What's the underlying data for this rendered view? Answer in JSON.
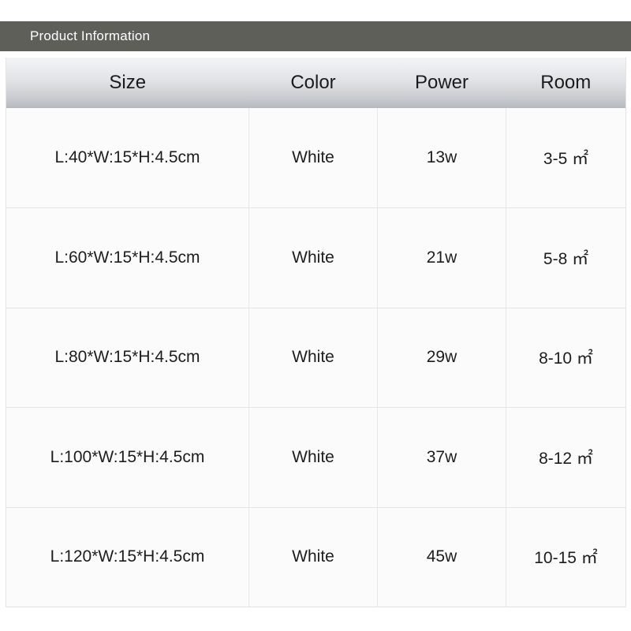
{
  "banner": {
    "title": "Product Information",
    "background_color": "#5f5f5a",
    "text_color": "#ffffff"
  },
  "table": {
    "columns": [
      {
        "key": "size",
        "label": "Size"
      },
      {
        "key": "color",
        "label": "Color"
      },
      {
        "key": "power",
        "label": "Power"
      },
      {
        "key": "room",
        "label": "Room"
      }
    ],
    "header_gradient_top": "#f2f3f5",
    "header_gradient_bottom": "#b4b7bc",
    "cell_background": "#fbfbfb",
    "border_color": "#e4e5e7",
    "rows": [
      {
        "size": "L:40*W:15*H:4.5cm",
        "color": "White",
        "power": "13w",
        "room": "3-5 ㎡"
      },
      {
        "size": "L:60*W:15*H:4.5cm",
        "color": "White",
        "power": "21w",
        "room": "5-8 ㎡"
      },
      {
        "size": "L:80*W:15*H:4.5cm",
        "color": "White",
        "power": "29w",
        "room": "8-10 ㎡"
      },
      {
        "size": "L:100*W:15*H:4.5cm",
        "color": "White",
        "power": "37w",
        "room": "8-12 ㎡"
      },
      {
        "size": "L:120*W:15*H:4.5cm",
        "color": "White",
        "power": "45w",
        "room": "10-15 ㎡"
      }
    ]
  }
}
